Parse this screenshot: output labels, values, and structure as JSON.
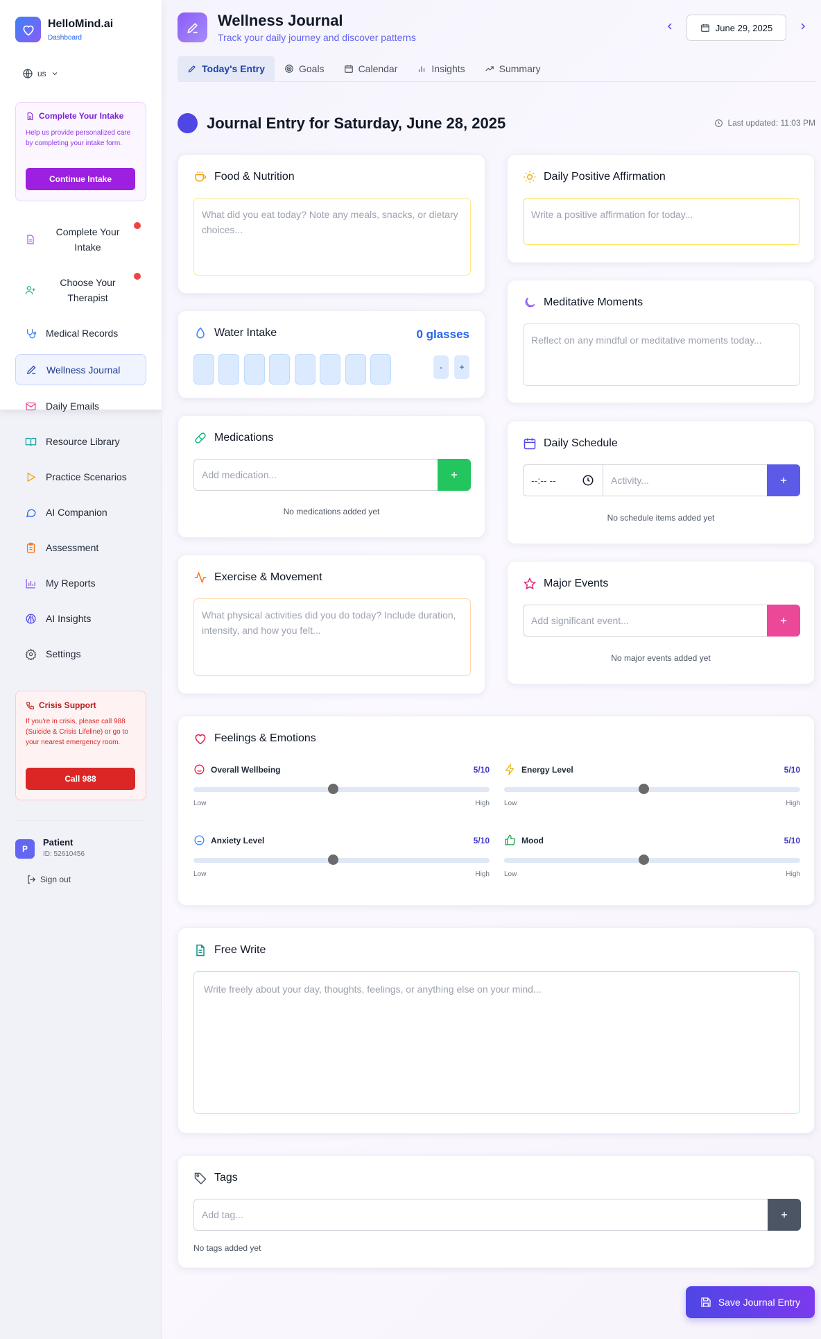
{
  "sidebar": {
    "brand": "HelloMind.ai",
    "brand_sub": "Dashboard",
    "language": "us",
    "intake_card": {
      "title": "Complete Your Intake",
      "desc": "Help us provide personalized care by completing your intake form.",
      "button": "Continue Intake"
    },
    "nav": [
      {
        "label": "Complete Your Intake",
        "icon": "file-icon"
      },
      {
        "label": "Choose Your Therapist",
        "icon": "user-plus-icon"
      },
      {
        "label": "Medical Records",
        "icon": "stethoscope-icon"
      },
      {
        "label": "Wellness Journal",
        "icon": "pen-icon"
      },
      {
        "label": "Daily Emails",
        "icon": "mail-icon"
      },
      {
        "label": "Resource Library",
        "icon": "book-icon"
      },
      {
        "label": "Practice Scenarios",
        "icon": "play-icon"
      },
      {
        "label": "AI Companion",
        "icon": "chat-icon"
      },
      {
        "label": "Assessment",
        "icon": "clipboard-icon"
      },
      {
        "label": "My Reports",
        "icon": "bar-chart-icon"
      },
      {
        "label": "AI Insights",
        "icon": "brain-icon"
      },
      {
        "label": "Settings",
        "icon": "gear-icon"
      }
    ],
    "crisis": {
      "title": "Crisis Support",
      "desc": "If you're in crisis, please call 988 (Suicide & Crisis Lifeline) or go to your nearest emergency room.",
      "button": "Call 988"
    },
    "user": {
      "initial": "P",
      "name": "Patient",
      "id": "ID: 52610456"
    },
    "signout": "Sign out"
  },
  "header": {
    "title": "Wellness Journal",
    "subtitle": "Track your daily journey and discover patterns",
    "date": "June 29, 2025",
    "tabs": [
      "Today's Entry",
      "Goals",
      "Calendar",
      "Insights",
      "Summary"
    ]
  },
  "entry": {
    "title": "Journal Entry for Saturday, June 28, 2025",
    "last_updated": "Last updated: 11:03 PM"
  },
  "food": {
    "title": "Food & Nutrition",
    "placeholder": "What did you eat today? Note any meals, snacks, or dietary choices..."
  },
  "water": {
    "title": "Water Intake",
    "count": "0 glasses",
    "minus": "-",
    "plus": "+"
  },
  "medications": {
    "title": "Medications",
    "placeholder": "Add medication...",
    "empty": "No medications added yet"
  },
  "exercise": {
    "title": "Exercise & Movement",
    "placeholder": "What physical activities did you do today? Include duration, intensity, and how you felt..."
  },
  "affirmation": {
    "title": "Daily Positive Affirmation",
    "placeholder": "Write a positive affirmation for today..."
  },
  "meditative": {
    "title": "Meditative Moments",
    "placeholder": "Reflect on any mindful or meditative moments today..."
  },
  "schedule": {
    "title": "Daily Schedule",
    "time_placeholder": "--:-- --",
    "activity_placeholder": "Activity...",
    "empty": "No schedule items added yet"
  },
  "events": {
    "title": "Major Events",
    "placeholder": "Add significant event...",
    "empty": "No major events added yet"
  },
  "feelings": {
    "title": "Feelings & Emotions",
    "low": "Low",
    "high": "High",
    "sliders": [
      {
        "label": "Overall Wellbeing",
        "value_text": "5/10",
        "value": 5,
        "icon": "smile-icon"
      },
      {
        "label": "Energy Level",
        "value_text": "5/10",
        "value": 5,
        "icon": "bolt-icon"
      },
      {
        "label": "Anxiety Level",
        "value_text": "5/10",
        "value": 5,
        "icon": "neutral-face-icon"
      },
      {
        "label": "Mood",
        "value_text": "5/10",
        "value": 5,
        "icon": "thumbs-up-icon"
      }
    ]
  },
  "freewrite": {
    "title": "Free Write",
    "placeholder": "Write freely about your day, thoughts, feelings, or anything else on your mind..."
  },
  "tags": {
    "title": "Tags",
    "placeholder": "Add tag...",
    "empty": "No tags added yet"
  },
  "save_button": "Save Journal Entry",
  "colors": {
    "accent": "#4f46e5",
    "purple": "#9d1fe0",
    "danger": "#dc2626",
    "success": "#22c55e",
    "pink": "#ec4899"
  }
}
